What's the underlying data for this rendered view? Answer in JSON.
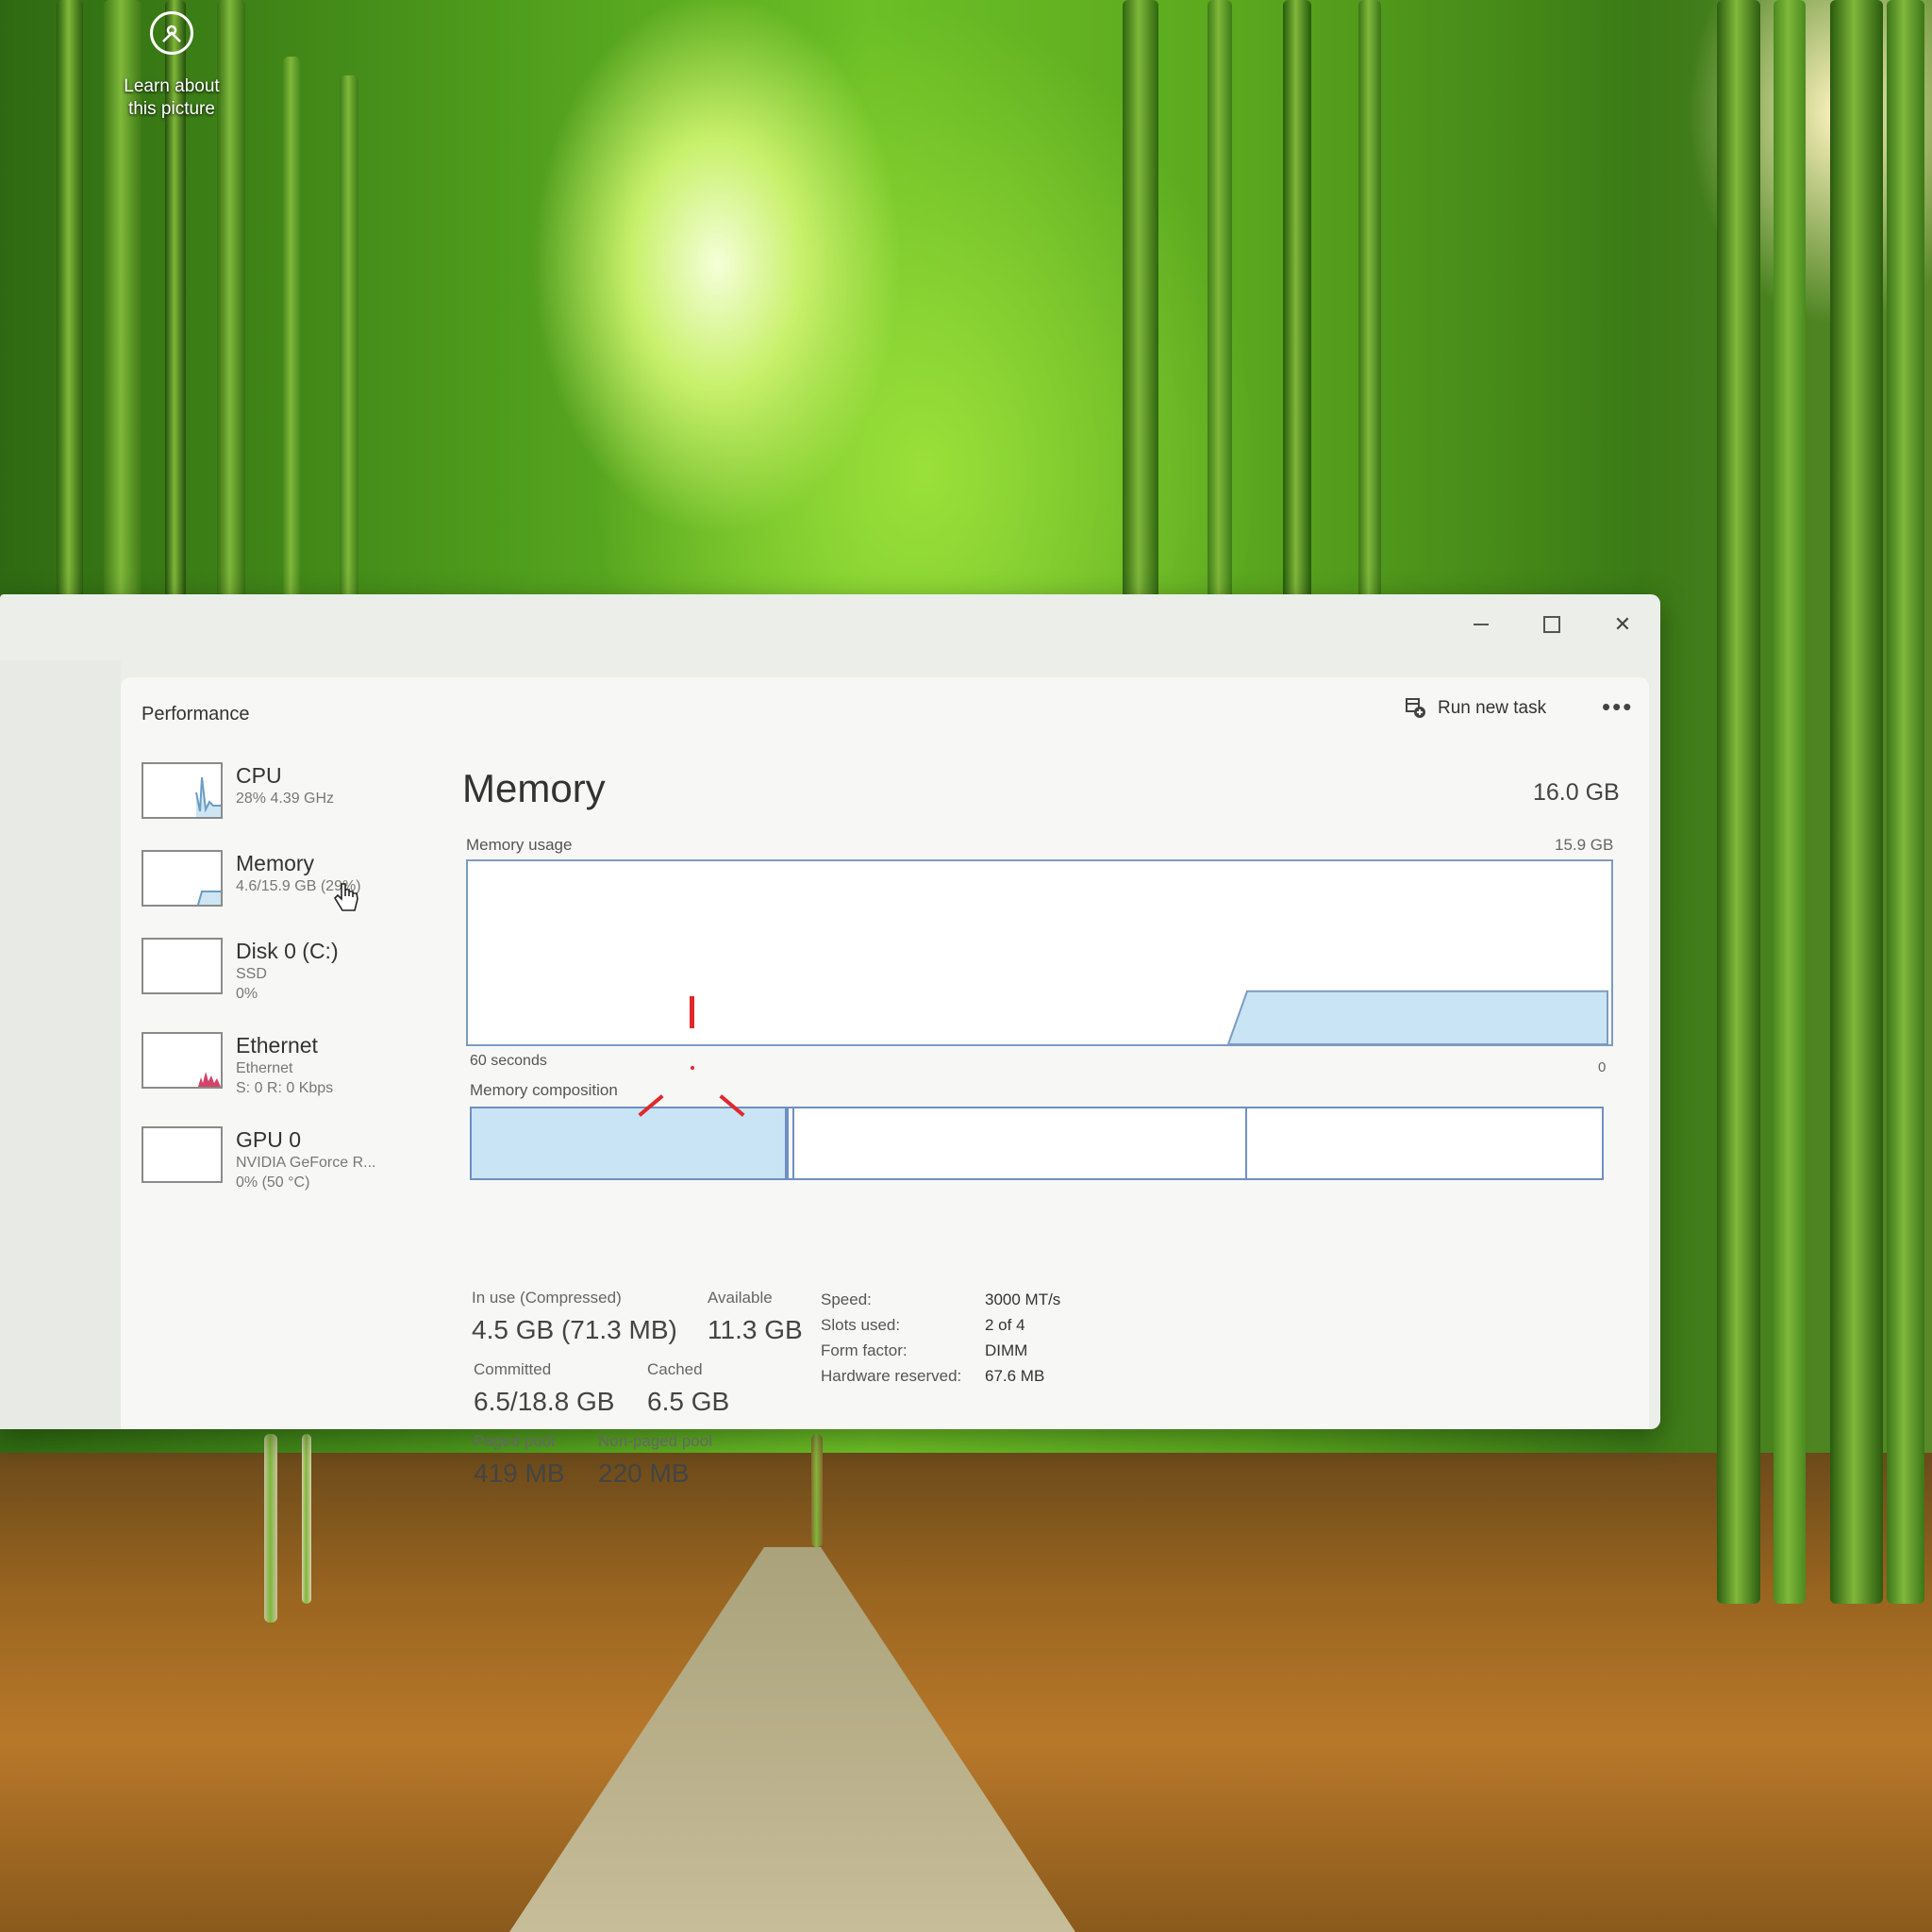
{
  "desktop": {
    "learn_icon": {
      "label_line1": "Learn about",
      "label_line2": "this picture",
      "icon": "camera-circle-icon"
    }
  },
  "window": {
    "controls": {
      "minimize_icon": "minimize-icon",
      "maximize_icon": "maximize-icon",
      "close_symbol": "✕"
    },
    "header": {
      "title": "Performance",
      "run_new_task_label": "Run new task",
      "more_symbol": "•••"
    },
    "sidebar": {
      "items": [
        {
          "name": "CPU",
          "sub1": "28% 4.39 GHz",
          "sub2": "",
          "sub3": ""
        },
        {
          "name": "Memory",
          "sub1": "4.6/15.9 GB (29%)",
          "sub2": "",
          "sub3": ""
        },
        {
          "name": "Disk 0 (C:)",
          "sub1": "SSD",
          "sub2": "0%",
          "sub3": ""
        },
        {
          "name": "Ethernet",
          "sub1": "Ethernet",
          "sub2": "S: 0 R: 0 Kbps",
          "sub3": ""
        },
        {
          "name": "GPU 0",
          "sub1": "NVIDIA GeForce R...",
          "sub2": "0% (50 °C)",
          "sub3": ""
        }
      ]
    },
    "memory": {
      "title": "Memory",
      "total": "16.0 GB",
      "usage_label": "Memory usage",
      "usage_max": "15.9 GB",
      "time_span": "60 seconds",
      "zero": "0",
      "composition_label": "Memory composition",
      "usage_fraction": 0.29,
      "stats": {
        "in_use_label": "In use (Compressed)",
        "in_use_value": "4.5 GB (71.3 MB)",
        "available_label": "Available",
        "available_value": "11.3 GB",
        "committed_label": "Committed",
        "committed_value": "6.5/18.8 GB",
        "cached_label": "Cached",
        "cached_value": "6.5 GB",
        "paged_label": "Paged pool",
        "paged_value": "419 MB",
        "nonpaged_label": "Non-paged pool",
        "nonpaged_value": "220 MB"
      },
      "specs": {
        "speed_label": "Speed:",
        "speed_value": "3000 MT/s",
        "slots_label": "Slots used:",
        "slots_value": "2 of 4",
        "form_label": "Form factor:",
        "form_value": "DIMM",
        "hw_label": "Hardware reserved:",
        "hw_value": "67.6 MB"
      }
    },
    "colors": {
      "graph_line": "#7d9bc0",
      "graph_fill": "#c9e4f5",
      "ethernet_spark": "#d2436a",
      "marker": "#e0292b"
    }
  }
}
